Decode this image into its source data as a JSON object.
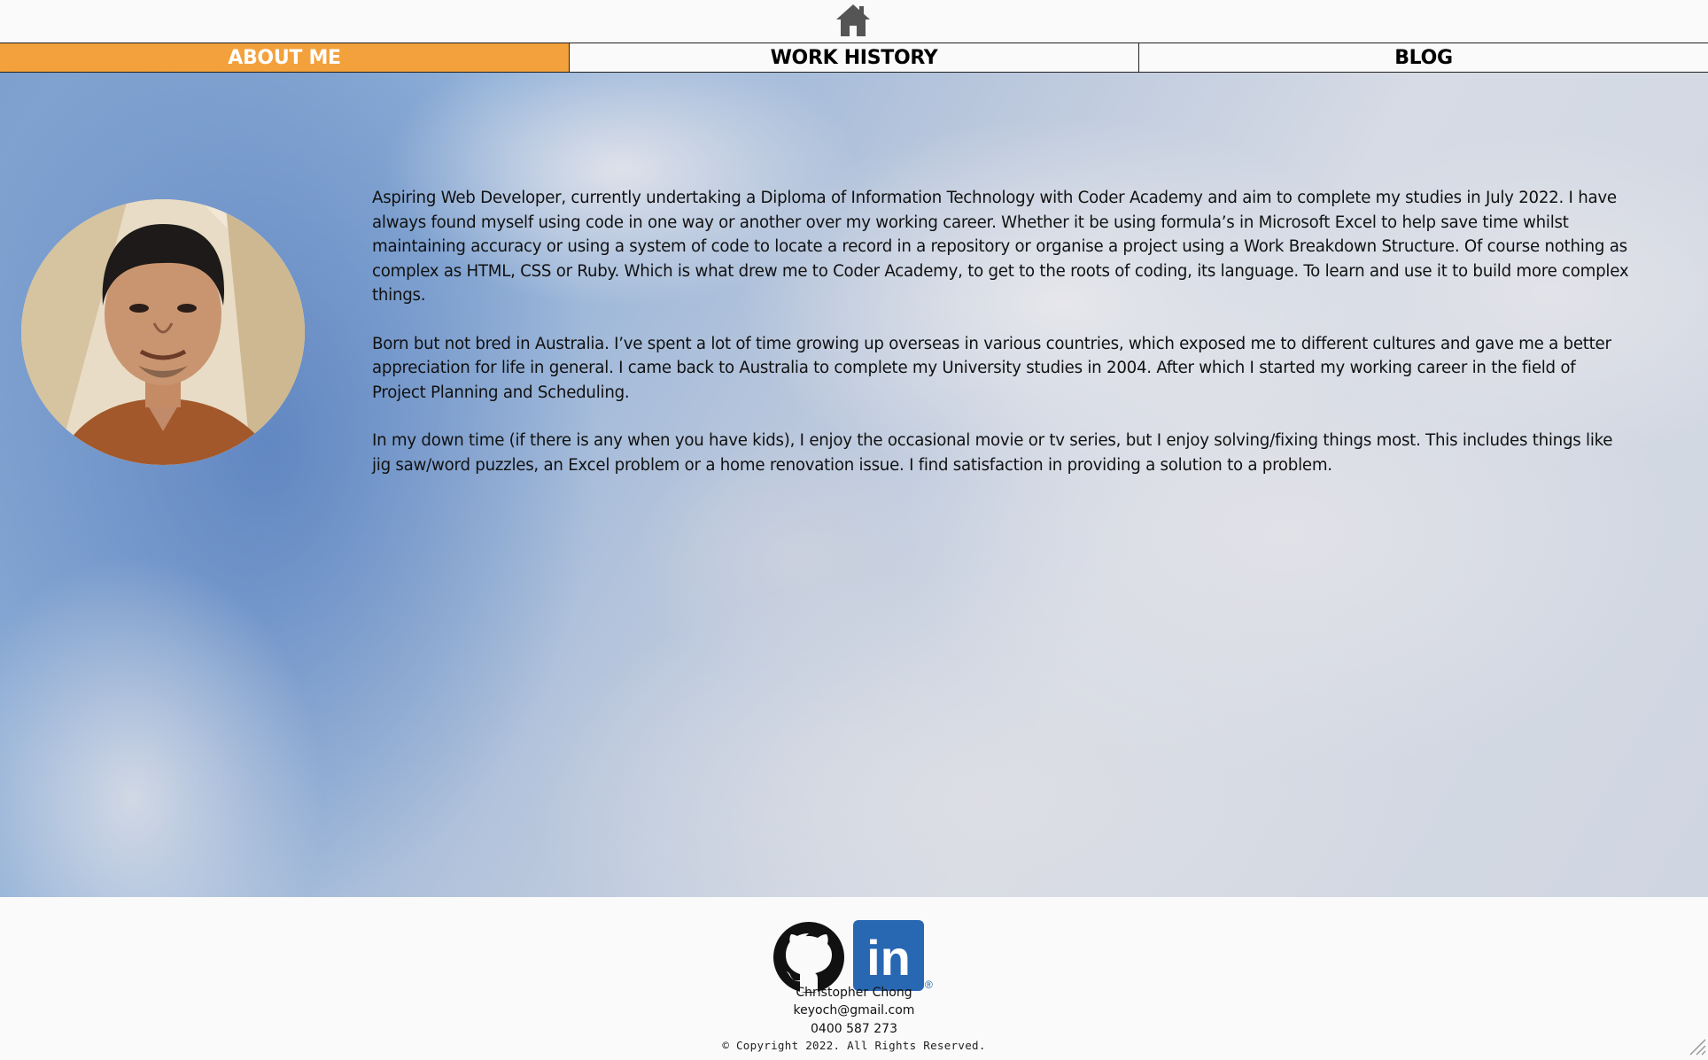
{
  "header": {
    "home_icon": "home-icon"
  },
  "nav": {
    "items": [
      {
        "label": "ABOUT ME",
        "active": true
      },
      {
        "label": "WORK HISTORY",
        "active": false
      },
      {
        "label": "BLOG",
        "active": false
      }
    ]
  },
  "colors": {
    "active_tab": "#f3a13c",
    "linkedin": "#2867b2"
  },
  "main": {
    "avatar": "profile-photo",
    "paragraphs": [
      "Aspiring Web Developer, currently undertaking a Diploma of Information Technology with Coder Academy and aim to complete my studies in July 2022. I have always found myself using code in one way or another over my working career. Whether it be using formula’s in Microsoft Excel to help save time whilst maintaining accuracy or using a system of code to locate a record in a repository or organise a project using a Work Breakdown Structure. Of course nothing as complex as HTML, CSS or Ruby. Which is what drew me to Coder Academy, to get to the roots of coding, its language. To learn and use it to build more complex things.",
      "Born but not bred in Australia. I’ve spent a lot of time growing up overseas in various countries, which exposed me to different cultures and gave me a better appreciation for life in general. I came back to Australia to complete my University studies in 2004. After which I started my working career in the field of Project Planning and Scheduling.",
      "In my down time (if there is any when you have kids), I enjoy the occasional movie or tv series, but I enjoy solving/fixing things most. This includes things like jig saw/word puzzles, an Excel problem or a home renovation issue. I find satisfaction in providing a solution to a problem."
    ]
  },
  "footer": {
    "social": [
      "github-icon",
      "linkedin-icon"
    ],
    "linkedin_text": "in",
    "registered": "®",
    "name": "Christopher Chong",
    "email": "keyoch@gmail.com",
    "phone": "0400 587 273",
    "copyright": "© Copyright 2022. All Rights Reserved."
  }
}
